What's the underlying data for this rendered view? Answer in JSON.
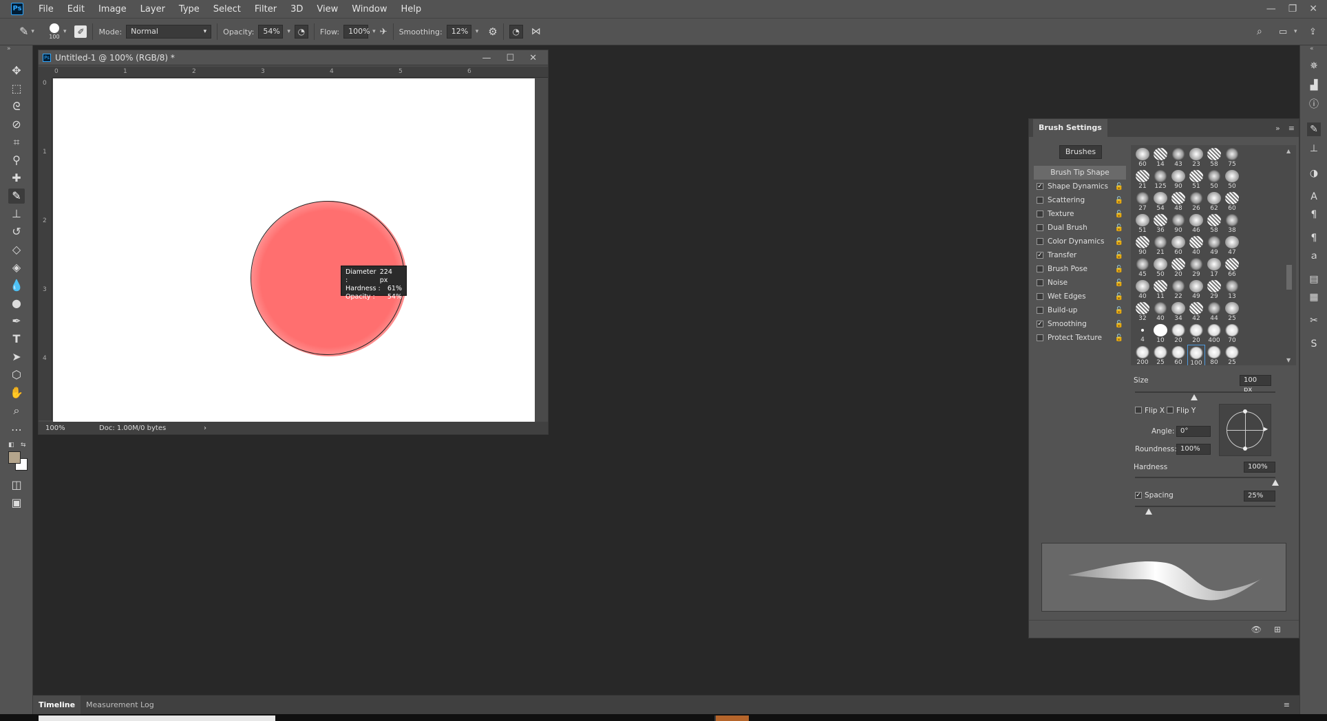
{
  "menubar": {
    "logo": "Ps",
    "items": [
      "File",
      "Edit",
      "Image",
      "Layer",
      "Type",
      "Select",
      "Filter",
      "3D",
      "View",
      "Window",
      "Help"
    ],
    "window_controls": [
      "minimize-icon",
      "restore-icon",
      "close-icon"
    ]
  },
  "options": {
    "brush_size": "100",
    "mode_label": "Mode:",
    "mode_value": "Normal",
    "opacity_label": "Opacity:",
    "opacity_value": "54%",
    "flow_label": "Flow:",
    "flow_value": "100%",
    "smoothing_label": "Smoothing:",
    "smoothing_value": "12%"
  },
  "document": {
    "title": "Untitled-1 @ 100% (RGB/8) *",
    "zoom": "100%",
    "doc_info": "Doc: 1.00M/0 bytes",
    "ruler_h": [
      "0",
      "1",
      "2",
      "3",
      "4",
      "5",
      "6"
    ],
    "ruler_v": [
      "0",
      "1",
      "2",
      "3",
      "4"
    ],
    "tooltip": {
      "diameter_label": "Diameter :",
      "diameter_value": "224 px",
      "hardness_label": "Hardness :",
      "hardness_value": "61%",
      "opacity_label": "Opacity :",
      "opacity_value": "54%"
    }
  },
  "panel": {
    "title": "Brush Settings",
    "brushes_button": "Brushes",
    "tip_items": [
      {
        "label": "Brush Tip Shape",
        "checkbox": false,
        "checked": false,
        "selected": true
      },
      {
        "label": "Shape Dynamics",
        "checkbox": true,
        "checked": true
      },
      {
        "label": "Scattering",
        "checkbox": true,
        "checked": false
      },
      {
        "label": "Texture",
        "checkbox": true,
        "checked": false
      },
      {
        "label": "Dual Brush",
        "checkbox": true,
        "checked": false
      },
      {
        "label": "Color Dynamics",
        "checkbox": true,
        "checked": false
      },
      {
        "label": "Transfer",
        "checkbox": true,
        "checked": true
      },
      {
        "label": "Brush Pose",
        "checkbox": true,
        "checked": false
      },
      {
        "label": "Noise",
        "checkbox": true,
        "checked": false
      },
      {
        "label": "Wet Edges",
        "checkbox": true,
        "checked": false
      },
      {
        "label": "Build-up",
        "checkbox": true,
        "checked": false
      },
      {
        "label": "Smoothing",
        "checkbox": true,
        "checked": true
      },
      {
        "label": "Protect Texture",
        "checkbox": true,
        "checked": false
      }
    ],
    "brush_presets": [
      [
        "60",
        "14",
        "43",
        "23",
        "58",
        "75"
      ],
      [
        "21",
        "125",
        "90",
        "51",
        "50",
        "50"
      ],
      [
        "27",
        "54",
        "48",
        "26",
        "62",
        "60"
      ],
      [
        "51",
        "36",
        "90",
        "46",
        "58",
        "38"
      ],
      [
        "90",
        "21",
        "60",
        "40",
        "49",
        "47"
      ],
      [
        "45",
        "50",
        "20",
        "29",
        "17",
        "66"
      ],
      [
        "40",
        "11",
        "22",
        "49",
        "29",
        "13"
      ],
      [
        "32",
        "40",
        "34",
        "42",
        "44",
        "25"
      ],
      [
        "4",
        "10",
        "20",
        "20",
        "400",
        "70"
      ],
      [
        "200",
        "25",
        "60",
        "100",
        "80",
        "25"
      ]
    ],
    "selected_preset": "100",
    "size_label": "Size",
    "size_value": "100 px",
    "size_level": 0.42,
    "flip_x_label": "Flip X",
    "flip_y_label": "Flip Y",
    "angle_label": "Angle:",
    "angle_value": "0°",
    "roundness_label": "Roundness:",
    "roundness_value": "100%",
    "hardness_label": "Hardness",
    "hardness_value": "100%",
    "hardness_level": 1.0,
    "spacing_label": "Spacing",
    "spacing_value": "25%",
    "spacing_level": 0.1
  },
  "bottom_tabs": [
    "Timeline",
    "Measurement Log"
  ],
  "colors": {
    "foreground": "#b4a58c",
    "background": "#ffffff",
    "brush_color": "#ff6f6f"
  }
}
